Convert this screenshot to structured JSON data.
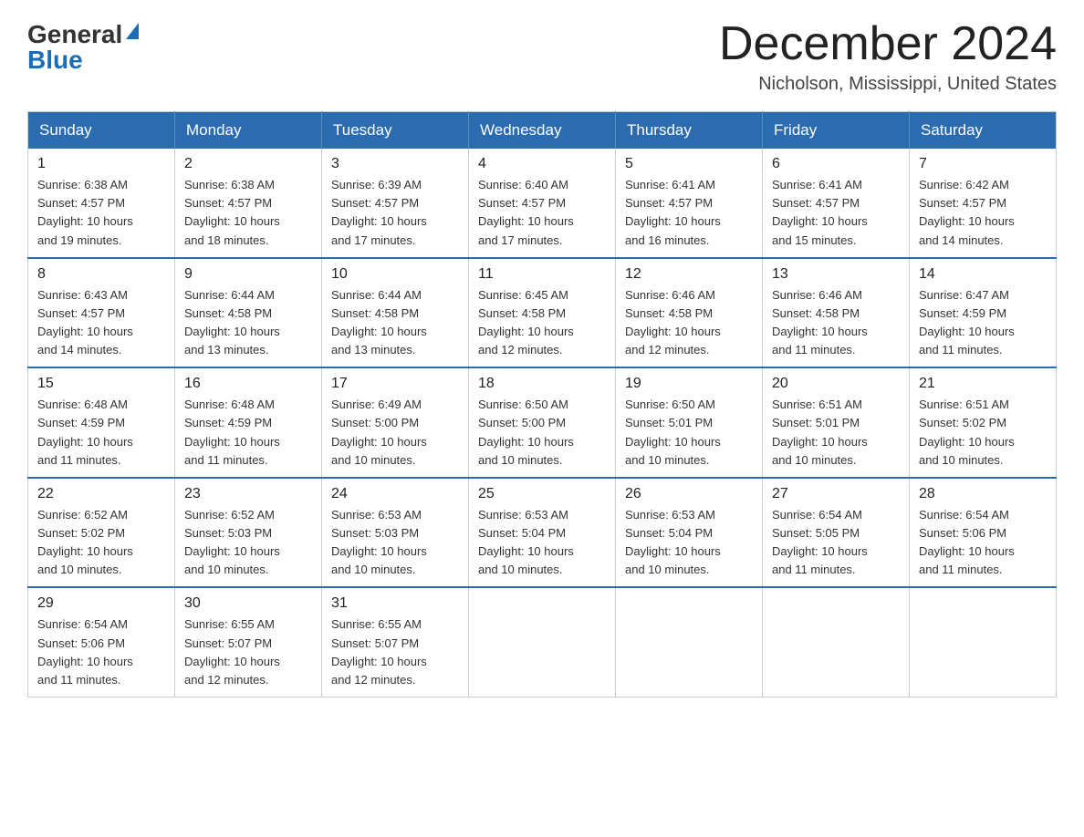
{
  "header": {
    "logo_general": "General",
    "logo_blue": "Blue",
    "month_title": "December 2024",
    "location": "Nicholson, Mississippi, United States"
  },
  "weekdays": [
    "Sunday",
    "Monday",
    "Tuesday",
    "Wednesday",
    "Thursday",
    "Friday",
    "Saturday"
  ],
  "weeks": [
    [
      {
        "day": "1",
        "sunrise": "6:38 AM",
        "sunset": "4:57 PM",
        "daylight": "10 hours and 19 minutes."
      },
      {
        "day": "2",
        "sunrise": "6:38 AM",
        "sunset": "4:57 PM",
        "daylight": "10 hours and 18 minutes."
      },
      {
        "day": "3",
        "sunrise": "6:39 AM",
        "sunset": "4:57 PM",
        "daylight": "10 hours and 17 minutes."
      },
      {
        "day": "4",
        "sunrise": "6:40 AM",
        "sunset": "4:57 PM",
        "daylight": "10 hours and 17 minutes."
      },
      {
        "day": "5",
        "sunrise": "6:41 AM",
        "sunset": "4:57 PM",
        "daylight": "10 hours and 16 minutes."
      },
      {
        "day": "6",
        "sunrise": "6:41 AM",
        "sunset": "4:57 PM",
        "daylight": "10 hours and 15 minutes."
      },
      {
        "day": "7",
        "sunrise": "6:42 AM",
        "sunset": "4:57 PM",
        "daylight": "10 hours and 14 minutes."
      }
    ],
    [
      {
        "day": "8",
        "sunrise": "6:43 AM",
        "sunset": "4:57 PM",
        "daylight": "10 hours and 14 minutes."
      },
      {
        "day": "9",
        "sunrise": "6:44 AM",
        "sunset": "4:58 PM",
        "daylight": "10 hours and 13 minutes."
      },
      {
        "day": "10",
        "sunrise": "6:44 AM",
        "sunset": "4:58 PM",
        "daylight": "10 hours and 13 minutes."
      },
      {
        "day": "11",
        "sunrise": "6:45 AM",
        "sunset": "4:58 PM",
        "daylight": "10 hours and 12 minutes."
      },
      {
        "day": "12",
        "sunrise": "6:46 AM",
        "sunset": "4:58 PM",
        "daylight": "10 hours and 12 minutes."
      },
      {
        "day": "13",
        "sunrise": "6:46 AM",
        "sunset": "4:58 PM",
        "daylight": "10 hours and 11 minutes."
      },
      {
        "day": "14",
        "sunrise": "6:47 AM",
        "sunset": "4:59 PM",
        "daylight": "10 hours and 11 minutes."
      }
    ],
    [
      {
        "day": "15",
        "sunrise": "6:48 AM",
        "sunset": "4:59 PM",
        "daylight": "10 hours and 11 minutes."
      },
      {
        "day": "16",
        "sunrise": "6:48 AM",
        "sunset": "4:59 PM",
        "daylight": "10 hours and 11 minutes."
      },
      {
        "day": "17",
        "sunrise": "6:49 AM",
        "sunset": "5:00 PM",
        "daylight": "10 hours and 10 minutes."
      },
      {
        "day": "18",
        "sunrise": "6:50 AM",
        "sunset": "5:00 PM",
        "daylight": "10 hours and 10 minutes."
      },
      {
        "day": "19",
        "sunrise": "6:50 AM",
        "sunset": "5:01 PM",
        "daylight": "10 hours and 10 minutes."
      },
      {
        "day": "20",
        "sunrise": "6:51 AM",
        "sunset": "5:01 PM",
        "daylight": "10 hours and 10 minutes."
      },
      {
        "day": "21",
        "sunrise": "6:51 AM",
        "sunset": "5:02 PM",
        "daylight": "10 hours and 10 minutes."
      }
    ],
    [
      {
        "day": "22",
        "sunrise": "6:52 AM",
        "sunset": "5:02 PM",
        "daylight": "10 hours and 10 minutes."
      },
      {
        "day": "23",
        "sunrise": "6:52 AM",
        "sunset": "5:03 PM",
        "daylight": "10 hours and 10 minutes."
      },
      {
        "day": "24",
        "sunrise": "6:53 AM",
        "sunset": "5:03 PM",
        "daylight": "10 hours and 10 minutes."
      },
      {
        "day": "25",
        "sunrise": "6:53 AM",
        "sunset": "5:04 PM",
        "daylight": "10 hours and 10 minutes."
      },
      {
        "day": "26",
        "sunrise": "6:53 AM",
        "sunset": "5:04 PM",
        "daylight": "10 hours and 10 minutes."
      },
      {
        "day": "27",
        "sunrise": "6:54 AM",
        "sunset": "5:05 PM",
        "daylight": "10 hours and 11 minutes."
      },
      {
        "day": "28",
        "sunrise": "6:54 AM",
        "sunset": "5:06 PM",
        "daylight": "10 hours and 11 minutes."
      }
    ],
    [
      {
        "day": "29",
        "sunrise": "6:54 AM",
        "sunset": "5:06 PM",
        "daylight": "10 hours and 11 minutes."
      },
      {
        "day": "30",
        "sunrise": "6:55 AM",
        "sunset": "5:07 PM",
        "daylight": "10 hours and 12 minutes."
      },
      {
        "day": "31",
        "sunrise": "6:55 AM",
        "sunset": "5:07 PM",
        "daylight": "10 hours and 12 minutes."
      },
      null,
      null,
      null,
      null
    ]
  ],
  "labels": {
    "sunrise": "Sunrise:",
    "sunset": "Sunset:",
    "daylight": "Daylight:"
  }
}
